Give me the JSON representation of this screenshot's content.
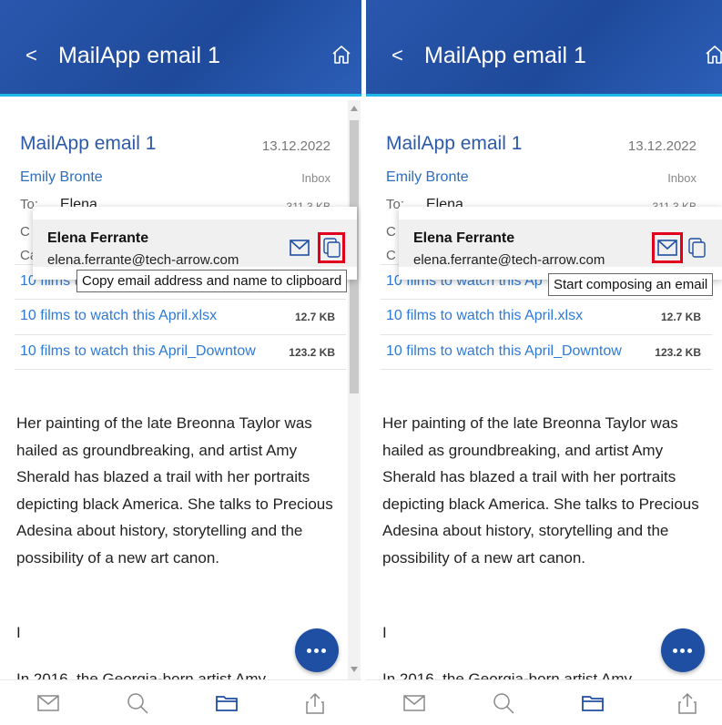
{
  "panels": [
    {
      "header": {
        "back_label": "<",
        "title": "MailApp email 1"
      },
      "email": {
        "subject": "MailApp email 1",
        "date": "13.12.2022",
        "sender": "Emily Bronte",
        "folder": "Inbox",
        "to_label": "To:",
        "to_value": "Elena",
        "size": "311.3 KB",
        "cc_partial": "C",
        "ca_partial": "Ca"
      },
      "contact_popup": {
        "name": "Elena Ferrante",
        "email": "elena.ferrante@tech-arrow.com"
      },
      "tooltip": "Copy email address and name to clipboard",
      "highlighted_button": "copy",
      "attachments": [
        {
          "name": "10 films to watch this April",
          "size": ""
        },
        {
          "name": "10 films to watch this April.xlsx",
          "size": "12.7 KB"
        },
        {
          "name": "10 films to watch this April_Downtow",
          "size": "123.2 KB"
        }
      ],
      "body": {
        "paragraph1": "Her painting of the late Breonna Taylor was hailed as groundbreaking, and artist Amy Sherald has blazed a trail with her portraits depicting black America. She talks to Precious Adesina about history, storytelling and the possibility of a new art canon.",
        "paragraph2": "I",
        "cut_line": "In 2016, the Georgia-born artist Amy"
      }
    },
    {
      "header": {
        "back_label": "<",
        "title": "MailApp email 1"
      },
      "email": {
        "subject": "MailApp email 1",
        "date": "13.12.2022",
        "sender": "Emily Bronte",
        "folder": "Inbox",
        "to_label": "To:",
        "to_value": "Elena",
        "size": "311.3 KB",
        "cc_partial": "C",
        "ca_partial": "C"
      },
      "contact_popup": {
        "name": "Elena Ferrante",
        "email": "elena.ferrante@tech-arrow.com"
      },
      "tooltip": "Start composing an email",
      "highlighted_button": "compose",
      "attachments": [
        {
          "name": "10 films to watch this Ap",
          "size": ""
        },
        {
          "name": "10 films to watch this April.xlsx",
          "size": "12.7 KB"
        },
        {
          "name": "10 films to watch this April_Downtow",
          "size": "123.2 KB"
        }
      ],
      "body": {
        "paragraph1": "Her painting of the late Breonna Taylor was hailed as groundbreaking, and artist Amy Sherald has blazed a trail with her portraits depicting black America. She talks to Precious Adesina about history, storytelling and the possibility of a new art canon.",
        "paragraph2": "I",
        "cut_line": "In 2016, the Georgia-born artist Amy"
      }
    }
  ],
  "bottom_nav": [
    "mail-icon",
    "search-icon",
    "folder-icon",
    "share-icon"
  ],
  "colors": {
    "header": "#2456a8",
    "accent": "#1bb8e8",
    "link": "#2e7ad6",
    "highlight": "#e0001b",
    "fab": "#1e4fa3"
  }
}
